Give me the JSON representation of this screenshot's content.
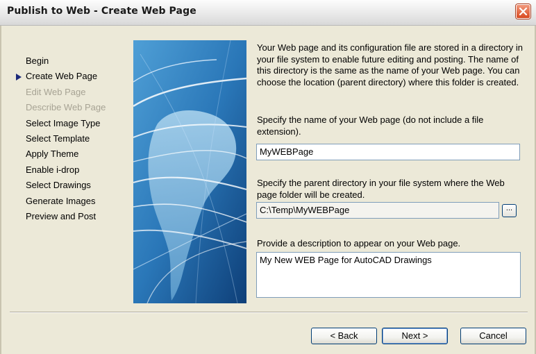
{
  "window": {
    "title": "Publish to Web - Create Web Page",
    "close_icon": "close-icon",
    "close_color": "#d8481f"
  },
  "steps": [
    {
      "label": "Begin",
      "state": "enabled"
    },
    {
      "label": "Create Web Page",
      "state": "current"
    },
    {
      "label": "Edit Web Page",
      "state": "disabled"
    },
    {
      "label": "Describe Web Page",
      "state": "disabled"
    },
    {
      "label": "Select Image Type",
      "state": "enabled"
    },
    {
      "label": "Select Template",
      "state": "enabled"
    },
    {
      "label": "Apply Theme",
      "state": "enabled"
    },
    {
      "label": "Enable i-drop",
      "state": "enabled"
    },
    {
      "label": "Select Drawings",
      "state": "enabled"
    },
    {
      "label": "Generate Images",
      "state": "enabled"
    },
    {
      "label": "Preview and Post",
      "state": "enabled"
    }
  ],
  "content": {
    "intro": "Your Web page and its configuration file are stored in a directory in your file system to enable future editing and posting.  The name of this directory is the same as the name of your Web page.  You can choose the location (parent directory) where this folder is created.",
    "name_prompt": "Specify the name of your Web page (do not include a file extension).",
    "name_value": "MyWEBPage",
    "dir_prompt": "Specify the parent directory in your file system where the Web page folder will be created.",
    "dir_value": "C:\\Temp\\MyWEBPage",
    "browse_label": "...",
    "desc_prompt": "Provide a description to appear on your Web page.",
    "desc_value": "My New WEB Page for AutoCAD Drawings"
  },
  "buttons": {
    "back": "< Back",
    "next": "Next >",
    "cancel": "Cancel"
  },
  "colors": {
    "accent": "#003c74",
    "dialog_bg": "#ece9d8",
    "current_step_arrow": "#1c2a7a"
  }
}
